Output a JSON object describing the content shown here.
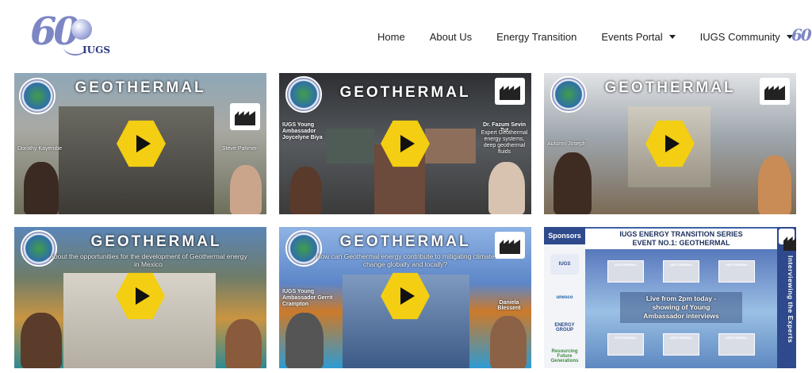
{
  "header": {
    "logo": {
      "main": "60",
      "sub": "IUGS"
    },
    "nav": [
      {
        "label": "Home",
        "dropdown": false
      },
      {
        "label": "About Us",
        "dropdown": false
      },
      {
        "label": "Energy Transition",
        "dropdown": false
      },
      {
        "label": "Events Portal",
        "dropdown": true
      },
      {
        "label": "IUGS Community",
        "dropdown": true
      }
    ],
    "nav_logo": "60"
  },
  "videos": [
    {
      "title": "GEOTHERMAL",
      "labels": [
        "Dorothy Kayembe",
        "Steve Pahmer"
      ]
    },
    {
      "title": "GEOTHERMAL",
      "labels": [
        "IUGS Young Ambassador Joycelyne Biya",
        "Dr. Fazum Sevin Tut",
        "Expert Geothermal energy systems, deep geothermal fluids"
      ]
    },
    {
      "title": "GEOTHERMAL",
      "labels": [
        "Autumn Joseph"
      ]
    },
    {
      "title": "GEOTHERMAL",
      "subtitle": "About the opportunities for the development of Geothermal energy in Mexico"
    },
    {
      "title": "GEOTHERMAL",
      "subtitle": "How can Geothermal energy contribute to mitigating climate change globally and locally?",
      "labels": [
        "IUGS Young Ambassador Gerrit Crampton",
        "Daniela Blessent"
      ]
    },
    {
      "sponsors_label": "Sponsors",
      "event_title_1": "IUGS ENERGY TRANSITION SERIES",
      "event_title_2": "EVENT NO.1: GEOTHERMAL",
      "live_1": "Live from 2pm today -",
      "live_2": "showing of Young",
      "live_3": "Ambassador interviews",
      "side_text": "Interviewing the Experts",
      "sponsor_logos": [
        "IUGS",
        "unesco",
        "ENERGY GROUP",
        "Resourcing Future Generations"
      ],
      "thumb_label": "GEOTHERMAL"
    }
  ],
  "colors": {
    "play_button": "#f3ce12",
    "brand": "#7d86c4",
    "event_blue": "#2e4a8c"
  }
}
